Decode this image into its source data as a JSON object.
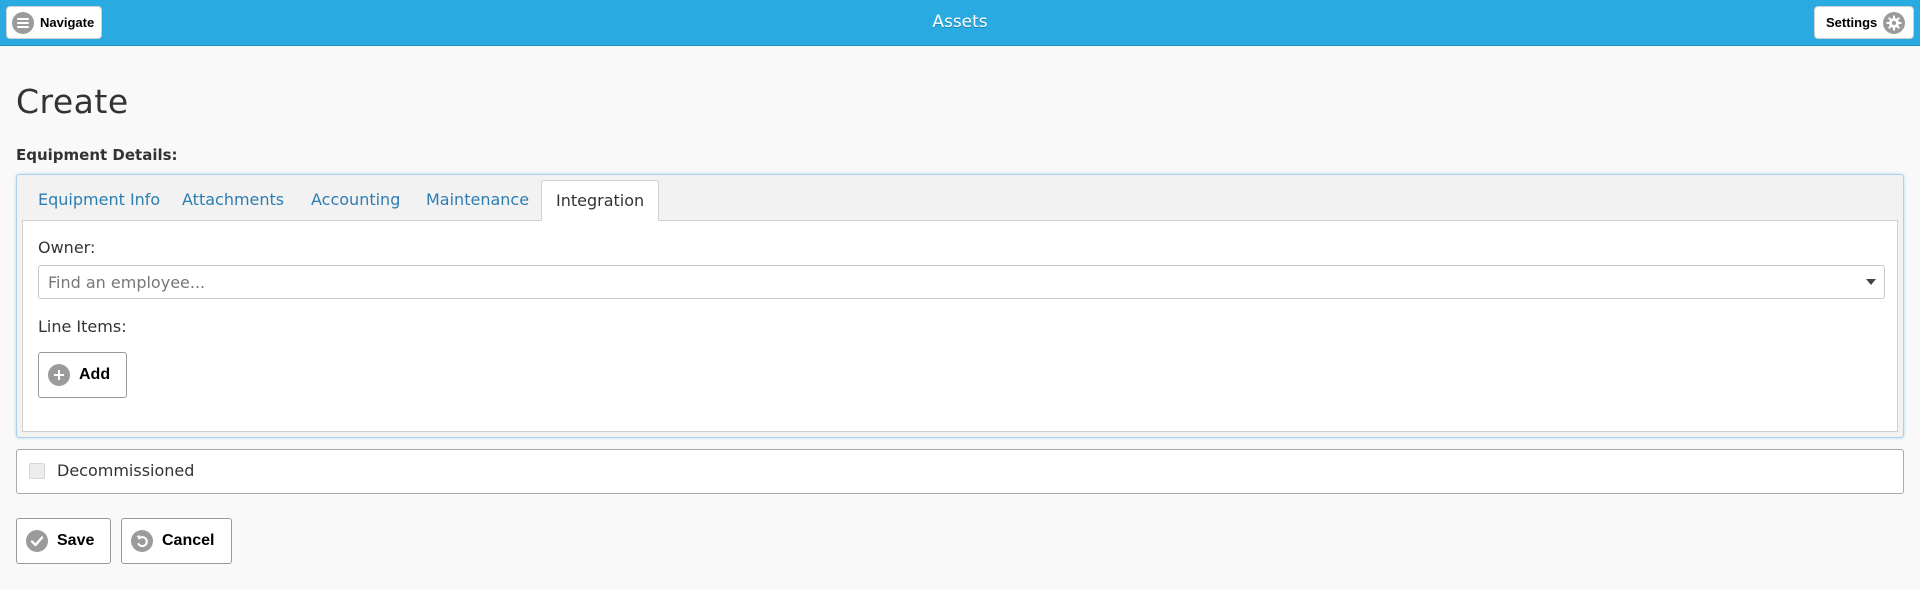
{
  "header": {
    "title": "Assets",
    "navigate_label": "Navigate",
    "settings_label": "Settings",
    "color": "#29abe2"
  },
  "page": {
    "title": "Create",
    "section_label": "Equipment Details:"
  },
  "tabs": [
    {
      "label": "Equipment Info",
      "active": false
    },
    {
      "label": "Attachments",
      "active": false
    },
    {
      "label": "Accounting",
      "active": false
    },
    {
      "label": "Maintenance",
      "active": false
    },
    {
      "label": "Integration",
      "active": true
    }
  ],
  "integration": {
    "owner_label": "Owner:",
    "owner_placeholder": "Find an employee...",
    "owner_value": "",
    "line_items_label": "Line Items:",
    "add_label": "Add"
  },
  "decommissioned": {
    "label": "Decommissioned",
    "checked": false
  },
  "actions": {
    "save_label": "Save",
    "cancel_label": "Cancel"
  },
  "icons": {
    "navigate": "menu-icon",
    "settings": "gear-icon",
    "add": "plus-icon",
    "save": "check-icon",
    "cancel": "undo-icon",
    "dropdown": "caret-down-icon"
  }
}
